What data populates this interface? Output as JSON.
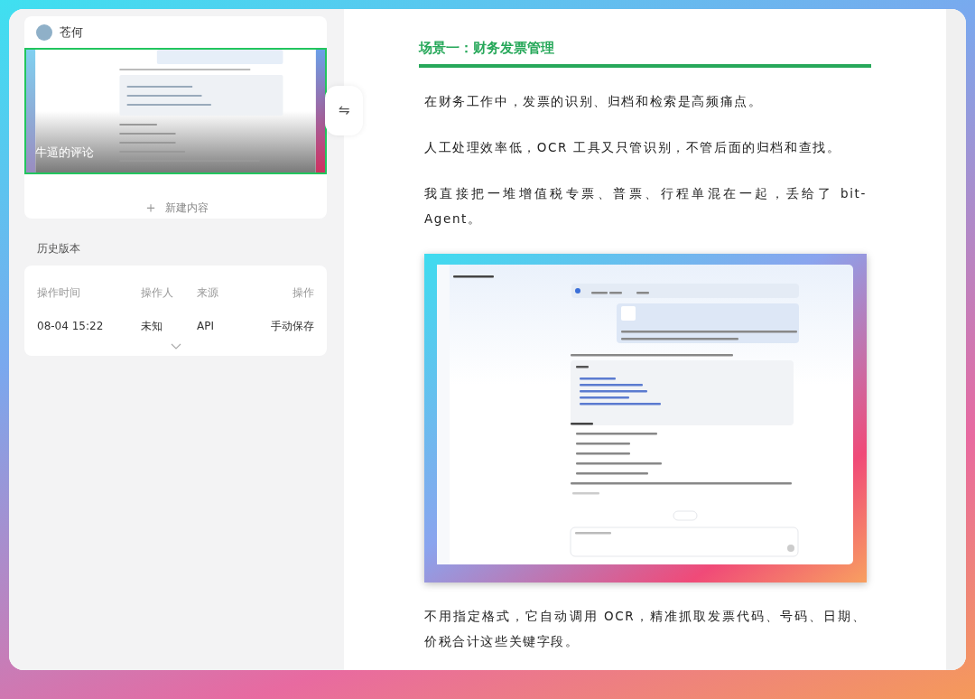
{
  "sidebar": {
    "author": "苍何",
    "thumbnail": {
      "caption": "牛逼的评论",
      "selected": true
    },
    "new_button": {
      "icon": "＋",
      "label": "新建内容"
    },
    "history_title": "历史版本",
    "history_table": {
      "columns": [
        "操作时间",
        "操作人",
        "来源",
        "操作"
      ],
      "rows": [
        [
          "08-04 15:22",
          "未知",
          "API",
          "手动保存"
        ]
      ]
    }
  },
  "toggle_button": "⇋",
  "article": {
    "heading": "场景一：财务发票管理",
    "blocks": [
      {
        "kind": "paragraph",
        "text": "在财务工作中，发票的识别、归档和检索是高频痛点。"
      },
      {
        "kind": "paragraph",
        "text": "人工处理效率低，OCR 工具又只管识别，不管后面的归档和查找。"
      },
      {
        "kind": "paragraph",
        "text": "我直接把一堆增值税专票、普票、行程单混在一起，丢给了 bit-Agent。"
      },
      {
        "kind": "screenshot"
      },
      {
        "kind": "paragraph",
        "text": "不用指定格式，它自动调用 OCR，精准抓取发票代码、号码、日期、价税合计这些关键字段。"
      }
    ]
  }
}
